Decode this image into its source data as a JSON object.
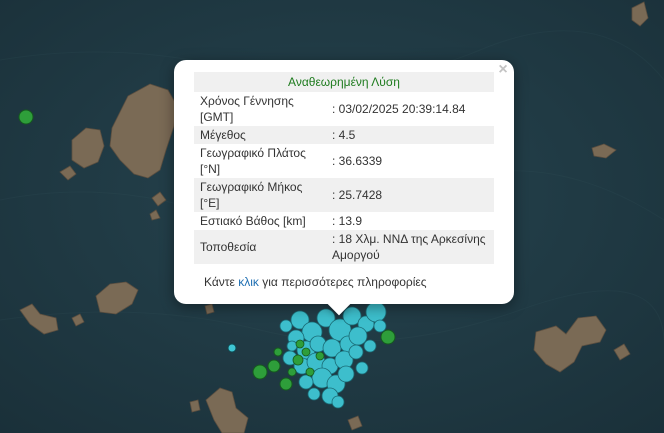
{
  "popup": {
    "title": "Αναθεωρημένη Λύση",
    "close_symbol": "×",
    "rows": [
      {
        "label": "Χρόνος Γέννησης [GMT]",
        "value": ": 03/02/2025 20:39:14.84"
      },
      {
        "label": "Μέγεθος",
        "value": ": 4.5"
      },
      {
        "label": "Γεωγραφικό Πλάτος [°N]",
        "value": ": 36.6339"
      },
      {
        "label": "Γεωγραφικό Μήκος [°E]",
        "value": ": 25.7428"
      },
      {
        "label": "Εστιακό Βάθος [km]",
        "value": ": 13.9"
      },
      {
        "label": "Τοποθεσία",
        "value": ": 18 Χλμ. ΝΝΔ της Αρκεσίνης Αμοργού"
      }
    ],
    "more_prefix": "Κάντε",
    "more_link": "κλικ",
    "more_suffix": "για περισσότερες πληροφορίες"
  },
  "map": {
    "background_color": "#1f3a44",
    "marker_colors": {
      "recent": "#3fc6d4",
      "older": "#2e9e3a"
    }
  }
}
